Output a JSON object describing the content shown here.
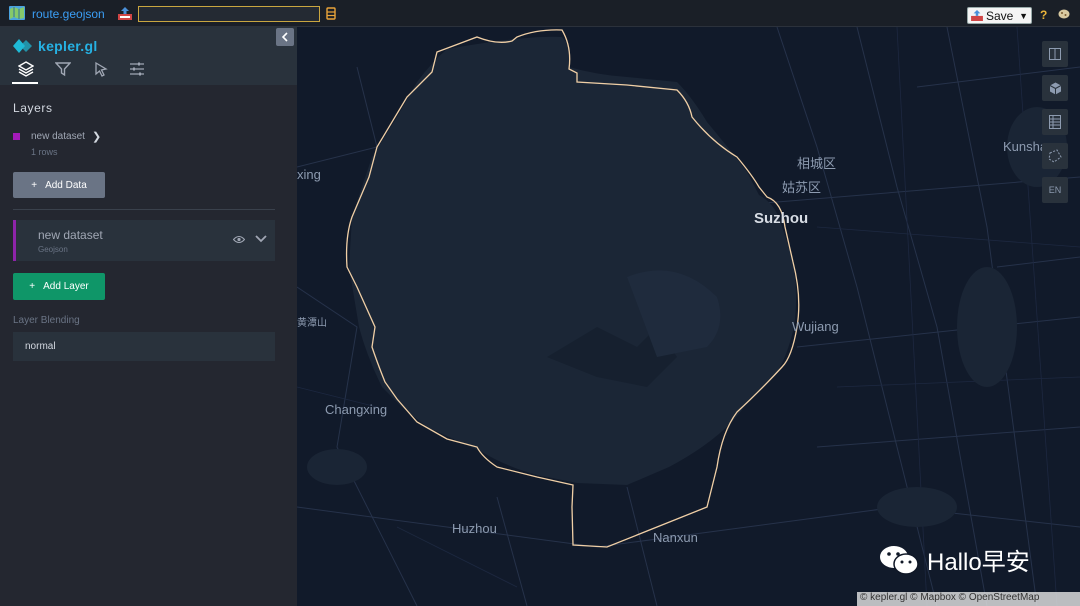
{
  "topbar": {
    "file_name": "route.geojson",
    "url_value": "",
    "save_label": "Save",
    "help_label": "?"
  },
  "sidepanel": {
    "logo_text": "kepler.gl",
    "section_title": "Layers",
    "dataset": {
      "name": "new dataset",
      "rows": "1 rows",
      "color": "#a41ab9"
    },
    "add_data_label": "Add Data",
    "layer": {
      "title": "new dataset",
      "type": "Geojson"
    },
    "add_layer_label": "Add Layer",
    "blending_label": "Layer Blending",
    "blending_value": "normal",
    "tabs": [
      "layers-icon",
      "filter-icon",
      "interaction-icon",
      "map-style-icon"
    ]
  },
  "map": {
    "labels": {
      "xing": "xing",
      "xiangcheng": "相城区",
      "gusu": "姑苏区",
      "suzhou": "Suzhou",
      "kunshan": "Kunsha",
      "wujiang": "Wujiang",
      "changxing": "Changxing",
      "huzhou": "Huzhou",
      "nanxun": "Nanxun",
      "mountain": "黄潭山"
    },
    "tools": {
      "language": "EN"
    },
    "attribution": "© kepler.gl © Mapbox © OpenStreetMap",
    "watermark": "Hallo早安"
  }
}
